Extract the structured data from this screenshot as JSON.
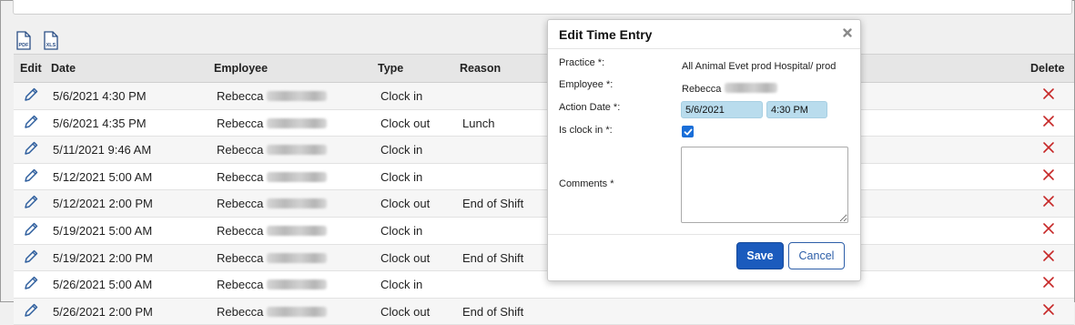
{
  "export": {
    "pdf_label": "PDF",
    "xls_label": "XLS"
  },
  "grid": {
    "columns": {
      "edit": "Edit",
      "date": "Date",
      "employee": "Employee",
      "type": "Type",
      "reason": "Reason",
      "delete": "Delete"
    },
    "rows": [
      {
        "date": "5/6/2021 4:30 PM",
        "employee": "Rebecca",
        "type": "Clock in",
        "reason": ""
      },
      {
        "date": "5/6/2021 4:35 PM",
        "employee": "Rebecca",
        "type": "Clock out",
        "reason": "Lunch"
      },
      {
        "date": "5/11/2021 9:46 AM",
        "employee": "Rebecca",
        "type": "Clock in",
        "reason": ""
      },
      {
        "date": "5/12/2021 5:00 AM",
        "employee": "Rebecca",
        "type": "Clock in",
        "reason": ""
      },
      {
        "date": "5/12/2021 2:00 PM",
        "employee": "Rebecca",
        "type": "Clock out",
        "reason": "End of Shift"
      },
      {
        "date": "5/19/2021 5:00 AM",
        "employee": "Rebecca",
        "type": "Clock in",
        "reason": ""
      },
      {
        "date": "5/19/2021 2:00 PM",
        "employee": "Rebecca",
        "type": "Clock out",
        "reason": "End of Shift"
      },
      {
        "date": "5/26/2021 5:00 AM",
        "employee": "Rebecca",
        "type": "Clock in",
        "reason": ""
      },
      {
        "date": "5/26/2021 2:00 PM",
        "employee": "Rebecca",
        "type": "Clock out",
        "reason": "End of Shift"
      }
    ]
  },
  "modal": {
    "title": "Edit Time Entry",
    "practice_label": "Practice *:",
    "practice_value": "All Animal Evet prod Hospital/ prod",
    "employee_label": "Employee *:",
    "employee_value": "Rebecca",
    "action_date_label": "Action Date *:",
    "action_date_value": "5/6/2021",
    "action_time_value": "4:30 PM",
    "is_clock_in_label": "Is clock in *:",
    "is_clock_in_checked": true,
    "comments_label": "Comments *",
    "comments_value": "",
    "save_label": "Save",
    "cancel_label": "Cancel"
  },
  "colors": {
    "accent": "#1b5bbd",
    "delete": "#c62828",
    "edit_icon": "#2f5f9e",
    "field_highlight": "#b9dced"
  }
}
